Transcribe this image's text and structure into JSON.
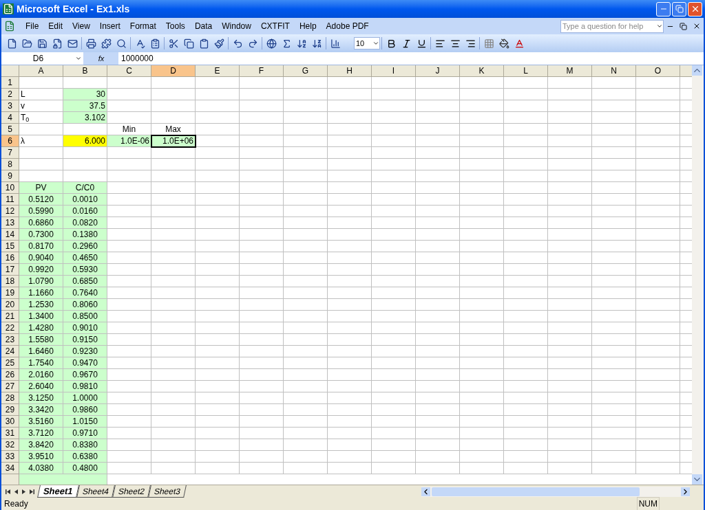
{
  "window": {
    "title": "Microsoft Excel - Ex1.xls"
  },
  "menu": [
    "File",
    "Edit",
    "View",
    "Insert",
    "Format",
    "Tools",
    "Data",
    "Window",
    "CXTFIT",
    "Help",
    "Adobe PDF"
  ],
  "help_box": {
    "placeholder": "Type a question for help"
  },
  "font_size": "10",
  "formula_bar": {
    "name_box": "D6",
    "fx": "fx",
    "value": "1000000"
  },
  "columns": [
    {
      "label": "A",
      "selected": false
    },
    {
      "label": "B",
      "selected": false
    },
    {
      "label": "C",
      "selected": false
    },
    {
      "label": "D",
      "selected": true
    },
    {
      "label": "E",
      "selected": false
    },
    {
      "label": "F",
      "selected": false
    },
    {
      "label": "G",
      "selected": false
    },
    {
      "label": "H",
      "selected": false
    },
    {
      "label": "I",
      "selected": false
    },
    {
      "label": "J",
      "selected": false
    },
    {
      "label": "K",
      "selected": false
    },
    {
      "label": "L",
      "selected": false
    },
    {
      "label": "M",
      "selected": false
    },
    {
      "label": "N",
      "selected": false
    },
    {
      "label": "O",
      "selected": false
    }
  ],
  "rows": [
    {
      "header": "1",
      "selected": false,
      "cells": [
        {
          "selected": false
        },
        {
          "selected": false
        },
        {
          "selected": false
        },
        {
          "selected": false
        }
      ]
    },
    {
      "header": "2",
      "selected": false,
      "cells": [
        {
          "kind": "text",
          "value": "L",
          "selected": false
        },
        {
          "kind": "number",
          "value": "30",
          "color": "#ccffcc",
          "selected": false
        },
        {
          "selected": false
        },
        {
          "selected": false
        }
      ]
    },
    {
      "header": "3",
      "selected": false,
      "cells": [
        {
          "kind": "text",
          "value": "v",
          "selected": false
        },
        {
          "kind": "number",
          "value": "37.5",
          "color": "#ccffcc",
          "selected": false
        },
        {
          "selected": false
        },
        {
          "selected": false
        }
      ]
    },
    {
      "header": "4",
      "selected": false,
      "cells": [
        {
          "kind": "text",
          "value": "T$_{0}$",
          "selected": false
        },
        {
          "kind": "number",
          "value": "3.102",
          "color": "#ccffcc",
          "selected": false
        },
        {
          "selected": false
        },
        {
          "selected": false
        }
      ]
    },
    {
      "header": "5",
      "selected": false,
      "cells": [
        {
          "selected": false
        },
        {
          "selected": false
        },
        {
          "kind": "center",
          "value": "Min",
          "selected": false
        },
        {
          "kind": "center",
          "value": "Max",
          "selected": false
        }
      ]
    },
    {
      "header": "6",
      "selected": true,
      "cells": [
        {
          "kind": "text",
          "value": "λ",
          "selected": false
        },
        {
          "kind": "number",
          "value": "6.000",
          "color": "#ffff00",
          "selected": false
        },
        {
          "kind": "number",
          "value": "1.0E-06",
          "color": "#ccffcc",
          "selected": false
        },
        {
          "kind": "number",
          "value": "1.0E+06",
          "color": "#ccffcc",
          "selected": true
        }
      ]
    },
    {
      "header": "7",
      "selected": false,
      "cells": [
        {
          "selected": false
        },
        {
          "selected": false
        },
        {
          "selected": false
        },
        {
          "selected": false
        }
      ]
    },
    {
      "header": "8",
      "selected": false,
      "cells": [
        {
          "selected": false
        },
        {
          "selected": false
        },
        {
          "selected": false
        },
        {
          "selected": false
        }
      ]
    },
    {
      "header": "9",
      "selected": false,
      "cells": [
        {
          "selected": false
        },
        {
          "selected": false
        },
        {
          "selected": false
        },
        {
          "selected": false
        }
      ]
    },
    {
      "header": "10",
      "selected": false,
      "cells": [
        {
          "kind": "center",
          "value": "PV",
          "color": "#ccffcc",
          "selected": false
        },
        {
          "kind": "center",
          "value": "C/C0",
          "color": "#ccffcc",
          "selected": false
        },
        {
          "selected": false
        },
        {
          "selected": false
        }
      ]
    },
    {
      "header": "11",
      "selected": false,
      "cells": [
        {
          "kind": "center",
          "value": "0.5120",
          "color": "#ccffcc",
          "selected": false
        },
        {
          "kind": "center",
          "value": "0.0010",
          "color": "#ccffcc",
          "selected": false
        },
        {
          "selected": false
        },
        {
          "selected": false
        }
      ]
    },
    {
      "header": "12",
      "selected": false,
      "cells": [
        {
          "kind": "center",
          "value": "0.5990",
          "color": "#ccffcc",
          "selected": false
        },
        {
          "kind": "center",
          "value": "0.0160",
          "color": "#ccffcc",
          "selected": false
        },
        {
          "selected": false
        },
        {
          "selected": false
        }
      ]
    },
    {
      "header": "13",
      "selected": false,
      "cells": [
        {
          "kind": "center",
          "value": "0.6860",
          "color": "#ccffcc",
          "selected": false
        },
        {
          "kind": "center",
          "value": "0.0820",
          "color": "#ccffcc",
          "selected": false
        },
        {
          "selected": false
        },
        {
          "selected": false
        }
      ]
    },
    {
      "header": "14",
      "selected": false,
      "cells": [
        {
          "kind": "center",
          "value": "0.7300",
          "color": "#ccffcc",
          "selected": false
        },
        {
          "kind": "center",
          "value": "0.1380",
          "color": "#ccffcc",
          "selected": false
        },
        {
          "selected": false
        },
        {
          "selected": false
        }
      ]
    },
    {
      "header": "15",
      "selected": false,
      "cells": [
        {
          "kind": "center",
          "value": "0.8170",
          "color": "#ccffcc",
          "selected": false
        },
        {
          "kind": "center",
          "value": "0.2960",
          "color": "#ccffcc",
          "selected": false
        },
        {
          "selected": false
        },
        {
          "selected": false
        }
      ]
    },
    {
      "header": "16",
      "selected": false,
      "cells": [
        {
          "kind": "center",
          "value": "0.9040",
          "color": "#ccffcc",
          "selected": false
        },
        {
          "kind": "center",
          "value": "0.4650",
          "color": "#ccffcc",
          "selected": false
        },
        {
          "selected": false
        },
        {
          "selected": false
        }
      ]
    },
    {
      "header": "17",
      "selected": false,
      "cells": [
        {
          "kind": "center",
          "value": "0.9920",
          "color": "#ccffcc",
          "selected": false
        },
        {
          "kind": "center",
          "value": "0.5930",
          "color": "#ccffcc",
          "selected": false
        },
        {
          "selected": false
        },
        {
          "selected": false
        }
      ]
    },
    {
      "header": "18",
      "selected": false,
      "cells": [
        {
          "kind": "center",
          "value": "1.0790",
          "color": "#ccffcc",
          "selected": false
        },
        {
          "kind": "center",
          "value": "0.6850",
          "color": "#ccffcc",
          "selected": false
        },
        {
          "selected": false
        },
        {
          "selected": false
        }
      ]
    },
    {
      "header": "19",
      "selected": false,
      "cells": [
        {
          "kind": "center",
          "value": "1.1660",
          "color": "#ccffcc",
          "selected": false
        },
        {
          "kind": "center",
          "value": "0.7640",
          "color": "#ccffcc",
          "selected": false
        },
        {
          "selected": false
        },
        {
          "selected": false
        }
      ]
    },
    {
      "header": "20",
      "selected": false,
      "cells": [
        {
          "kind": "center",
          "value": "1.2530",
          "color": "#ccffcc",
          "selected": false
        },
        {
          "kind": "center",
          "value": "0.8060",
          "color": "#ccffcc",
          "selected": false
        },
        {
          "selected": false
        },
        {
          "selected": false
        }
      ]
    },
    {
      "header": "21",
      "selected": false,
      "cells": [
        {
          "kind": "center",
          "value": "1.3400",
          "color": "#ccffcc",
          "selected": false
        },
        {
          "kind": "center",
          "value": "0.8500",
          "color": "#ccffcc",
          "selected": false
        },
        {
          "selected": false
        },
        {
          "selected": false
        }
      ]
    },
    {
      "header": "22",
      "selected": false,
      "cells": [
        {
          "kind": "center",
          "value": "1.4280",
          "color": "#ccffcc",
          "selected": false
        },
        {
          "kind": "center",
          "value": "0.9010",
          "color": "#ccffcc",
          "selected": false
        },
        {
          "selected": false
        },
        {
          "selected": false
        }
      ]
    },
    {
      "header": "23",
      "selected": false,
      "cells": [
        {
          "kind": "center",
          "value": "1.5580",
          "color": "#ccffcc",
          "selected": false
        },
        {
          "kind": "center",
          "value": "0.9150",
          "color": "#ccffcc",
          "selected": false
        },
        {
          "selected": false
        },
        {
          "selected": false
        }
      ]
    },
    {
      "header": "24",
      "selected": false,
      "cells": [
        {
          "kind": "center",
          "value": "1.6460",
          "color": "#ccffcc",
          "selected": false
        },
        {
          "kind": "center",
          "value": "0.9230",
          "color": "#ccffcc",
          "selected": false
        },
        {
          "selected": false
        },
        {
          "selected": false
        }
      ]
    },
    {
      "header": "25",
      "selected": false,
      "cells": [
        {
          "kind": "center",
          "value": "1.7540",
          "color": "#ccffcc",
          "selected": false
        },
        {
          "kind": "center",
          "value": "0.9470",
          "color": "#ccffcc",
          "selected": false
        },
        {
          "selected": false
        },
        {
          "selected": false
        }
      ]
    },
    {
      "header": "26",
      "selected": false,
      "cells": [
        {
          "kind": "center",
          "value": "2.0160",
          "color": "#ccffcc",
          "selected": false
        },
        {
          "kind": "center",
          "value": "0.9670",
          "color": "#ccffcc",
          "selected": false
        },
        {
          "selected": false
        },
        {
          "selected": false
        }
      ]
    },
    {
      "header": "27",
      "selected": false,
      "cells": [
        {
          "kind": "center",
          "value": "2.6040",
          "color": "#ccffcc",
          "selected": false
        },
        {
          "kind": "center",
          "value": "0.9810",
          "color": "#ccffcc",
          "selected": false
        },
        {
          "selected": false
        },
        {
          "selected": false
        }
      ]
    },
    {
      "header": "28",
      "selected": false,
      "cells": [
        {
          "kind": "center",
          "value": "3.1250",
          "color": "#ccffcc",
          "selected": false
        },
        {
          "kind": "center",
          "value": "1.0000",
          "color": "#ccffcc",
          "selected": false
        },
        {
          "selected": false
        },
        {
          "selected": false
        }
      ]
    },
    {
      "header": "29",
      "selected": false,
      "cells": [
        {
          "kind": "center",
          "value": "3.3420",
          "color": "#ccffcc",
          "selected": false
        },
        {
          "kind": "center",
          "value": "0.9860",
          "color": "#ccffcc",
          "selected": false
        },
        {
          "selected": false
        },
        {
          "selected": false
        }
      ]
    },
    {
      "header": "30",
      "selected": false,
      "cells": [
        {
          "kind": "center",
          "value": "3.5160",
          "color": "#ccffcc",
          "selected": false
        },
        {
          "kind": "center",
          "value": "1.0150",
          "color": "#ccffcc",
          "selected": false
        },
        {
          "selected": false
        },
        {
          "selected": false
        }
      ]
    },
    {
      "header": "31",
      "selected": false,
      "cells": [
        {
          "kind": "center",
          "value": "3.7120",
          "color": "#ccffcc",
          "selected": false
        },
        {
          "kind": "center",
          "value": "0.9710",
          "color": "#ccffcc",
          "selected": false
        },
        {
          "selected": false
        },
        {
          "selected": false
        }
      ]
    },
    {
      "header": "32",
      "selected": false,
      "cells": [
        {
          "kind": "center",
          "value": "3.8420",
          "color": "#ccffcc",
          "selected": false
        },
        {
          "kind": "center",
          "value": "0.8380",
          "color": "#ccffcc",
          "selected": false
        },
        {
          "selected": false
        },
        {
          "selected": false
        }
      ]
    },
    {
      "header": "33",
      "selected": false,
      "cells": [
        {
          "kind": "center",
          "value": "3.9510",
          "color": "#ccffcc",
          "selected": false
        },
        {
          "kind": "center",
          "value": "0.6380",
          "color": "#ccffcc",
          "selected": false
        },
        {
          "selected": false
        },
        {
          "selected": false
        }
      ]
    },
    {
      "header": "34",
      "selected": false,
      "cells": [
        {
          "kind": "center",
          "value": "4.0380",
          "color": "#ccffcc",
          "selected": false
        },
        {
          "kind": "center",
          "value": "0.4800",
          "color": "#ccffcc",
          "selected": false
        },
        {
          "selected": false
        },
        {
          "selected": false
        }
      ]
    }
  ],
  "sheet_tabs": [
    {
      "label": "Sheet1",
      "selected": true
    },
    {
      "label": "Sheet4",
      "selected": false
    },
    {
      "label": "Sheet2",
      "selected": false
    },
    {
      "label": "Sheet3",
      "selected": false
    }
  ],
  "status_bar": {
    "text": "Ready",
    "indicator": "NUM"
  }
}
